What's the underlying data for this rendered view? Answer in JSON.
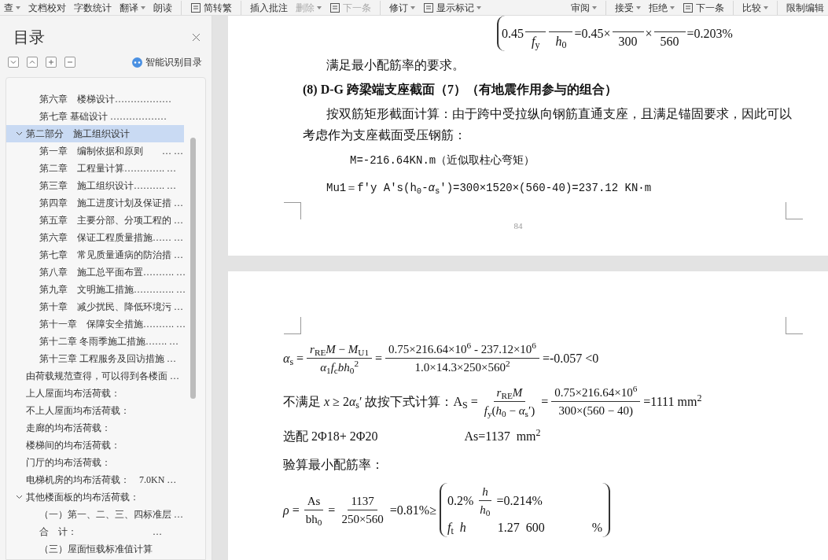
{
  "toolbar": {
    "left": [
      {
        "label": "查",
        "separator_before": false,
        "disabled": false,
        "dropdown": true,
        "icon": false
      },
      {
        "label": "文档校对",
        "separator_before": false,
        "disabled": false,
        "dropdown": false,
        "icon": false
      },
      {
        "label": "字数统计",
        "separator_before": false,
        "disabled": false,
        "dropdown": false,
        "icon": false
      },
      {
        "label": "翻译",
        "separator_before": false,
        "disabled": false,
        "dropdown": true,
        "icon": false
      },
      {
        "label": "朗读",
        "separator_before": false,
        "disabled": false,
        "dropdown": false,
        "icon": false
      },
      {
        "label": "简转繁",
        "separator_before": true,
        "disabled": false,
        "dropdown": false,
        "icon": true
      },
      {
        "label": "插入批注",
        "separator_before": true,
        "disabled": false,
        "dropdown": false,
        "icon": false
      },
      {
        "label": "删除",
        "separator_before": false,
        "disabled": true,
        "dropdown": true,
        "icon": false
      },
      {
        "label": "下一条",
        "separator_before": false,
        "disabled": true,
        "dropdown": false,
        "icon": true
      },
      {
        "label": "修订",
        "separator_before": true,
        "disabled": false,
        "dropdown": true,
        "icon": false
      },
      {
        "label": "显示标记",
        "separator_before": false,
        "disabled": false,
        "dropdown": true,
        "icon": true
      }
    ],
    "right": [
      {
        "label": "审阅",
        "separator_before": false,
        "disabled": false,
        "dropdown": true,
        "icon": false
      },
      {
        "label": "接受",
        "separator_before": true,
        "disabled": false,
        "dropdown": true,
        "icon": false
      },
      {
        "label": "拒绝",
        "separator_before": false,
        "disabled": false,
        "dropdown": true,
        "icon": false
      },
      {
        "label": "下一条",
        "separator_before": false,
        "disabled": false,
        "dropdown": false,
        "icon": true
      },
      {
        "label": "比较",
        "separator_before": true,
        "disabled": false,
        "dropdown": true,
        "icon": false
      },
      {
        "label": "限制编辑",
        "separator_before": true,
        "disabled": false,
        "dropdown": false,
        "icon": false
      }
    ]
  },
  "sidebar": {
    "title": "目录",
    "smart_label": "智能识别目录",
    "continued_children": [
      {
        "label": "第六章　楼梯设计………………",
        "selected": false
      },
      {
        "label": "第七章 基础设计 ………………",
        "selected": false
      }
    ],
    "items": [
      {
        "label": "第二部分　施工组织设计",
        "selected": true,
        "expanded": true,
        "children": [
          {
            "label": "第一章　编制依据和原则　　… …",
            "selected": false
          },
          {
            "label": "第二章　工程量计算…………. …",
            "selected": false
          },
          {
            "label": "第三章　施工组织设计………. …",
            "selected": false
          },
          {
            "label": "第四章　施工进度计划及保证措 …",
            "selected": false
          },
          {
            "label": "第五章　主要分部、分项工程的 …",
            "selected": false
          },
          {
            "label": "第六章　保证工程质量措施…… …",
            "selected": false
          },
          {
            "label": "第七章　常见质量通病的防治措 …",
            "selected": false
          },
          {
            "label": "第八章　施工总平面布置………. …",
            "selected": false
          },
          {
            "label": "第九章　文明施工措施…………. …",
            "selected": false
          },
          {
            "label": "第十章　减少扰民、降低环境污 …",
            "selected": false
          },
          {
            "label": "第十一章　保障安全措施………. …",
            "selected": false
          },
          {
            "label": "第十二章 冬雨季施工措施……. …",
            "selected": false
          },
          {
            "label": "第十三章 工程服务及回访措施 …",
            "selected": false
          }
        ]
      },
      {
        "label": "由荷载规范查得，可以得到各楼面 …",
        "selected": false
      },
      {
        "label": "上人屋面均布活荷载：",
        "selected": false
      },
      {
        "label": "不上人屋面均布活荷载：",
        "selected": false
      },
      {
        "label": "走廊的均布活荷载：",
        "selected": false
      },
      {
        "label": "楼梯间的均布活荷载：",
        "selected": false
      },
      {
        "label": "门厅的均布活荷载：",
        "selected": false
      },
      {
        "label": "电梯机房的均布活荷载：　7.0KN …",
        "selected": false
      },
      {
        "label": "其他楼面板的均布活荷载：",
        "selected": false,
        "expanded": true,
        "children": [
          {
            "label": "（一）第一、二、三、四标准层 …",
            "selected": false
          },
          {
            "label": "合　计：　　　　　　　　…",
            "selected": false
          },
          {
            "label": "（三）屋面恒载标准值计算",
            "selected": false
          }
        ]
      }
    ]
  },
  "pages": [
    {
      "page_number": "84",
      "blocks": [
        {
          "kind": "formula",
          "brace": true,
          "parts": [
            {
              "kind": "text",
              "text": "0.45"
            },
            {
              "kind": "under",
              "den": "*f*$_{y}$"
            },
            {
              "kind": "under",
              "den": "*h*$_{0}$"
            },
            {
              "kind": "text",
              "text": "=0.45×"
            },
            {
              "kind": "under",
              "den": "300"
            },
            {
              "kind": "text",
              "text": "×"
            },
            {
              "kind": "under",
              "den": "560"
            },
            {
              "kind": "text",
              "text": "=0.203%"
            }
          ]
        },
        {
          "kind": "indent",
          "text": "满足最小配筋率的要求。"
        },
        {
          "kind": "heading",
          "text": "(8) D-G 跨梁端支座截面（7）（有地震作用参与的组合）"
        },
        {
          "kind": "indent",
          "text": "按双筋矩形截面计算：由于跨中受拉纵向钢筋直通支座，且满足锚固要求，因此可以考虑作为支座截面受压钢筋："
        },
        {
          "kind": "mono",
          "text": "M=-216.64KN.m（近似取柱心弯矩）"
        },
        {
          "kind": "mono-indent",
          "text": "Mu1＝f'y A's(h$_{0}$-*α*$_{s}$')=300×1520×(560-40)=237.12 KN·m"
        }
      ]
    },
    {
      "blocks": [
        {
          "kind": "formula",
          "parts": [
            {
              "kind": "text",
              "text": "*α*$_{s}$ ="
            },
            {
              "kind": "frac",
              "num": "*r*$_{RE}$*M* − *M*$_{U1}$",
              "den": "*α*$_{1}$*f*$_{c}$*bh*$_{0}$$^{2}$"
            },
            {
              "kind": "text",
              "text": "="
            },
            {
              "kind": "frac",
              "num": "0.75×216.64×10$^{6}$ - 237.12×10$^{6}$",
              "den": "1.0×14.3×250×560$^{2}$"
            },
            {
              "kind": "text",
              "text": "=-0.057 <0"
            }
          ]
        },
        {
          "kind": "formula",
          "parts": [
            {
              "kind": "text",
              "text": "不满足 *x* ≥ 2"
            },
            {
              "kind": "text",
              "text": "*α*$_{s}$′ 故按下式计算：A$_{S}$ ="
            },
            {
              "kind": "frac",
              "num": "*r*$_{RE}$*M*",
              "den": "*f*$_{y}$(*h*$_{0}$ − *α*$_{s}$′)"
            },
            {
              "kind": "text",
              "text": "="
            },
            {
              "kind": "frac",
              "num": "0.75×216.64×10$^{6}$",
              "den": "300×(560 − 40)"
            },
            {
              "kind": "text",
              "text": "=1111 mm$^{2}$"
            }
          ]
        },
        {
          "kind": "formula",
          "parts": [
            {
              "kind": "text",
              "text": "选配 2Φ18+ 2Φ20"
            },
            {
              "kind": "gap"
            },
            {
              "kind": "text",
              "text": "As=1137  mm$^{2}$"
            }
          ]
        },
        {
          "kind": "plain",
          "text": "验算最小配筋率："
        },
        {
          "kind": "formula",
          "parts": [
            {
              "kind": "text",
              "text": "*ρ* ="
            },
            {
              "kind": "frac",
              "num": "As",
              "den": "bh$_{0}$"
            },
            {
              "kind": "text",
              "text": "="
            },
            {
              "kind": "frac",
              "num": "1137",
              "den": "250×560"
            },
            {
              "kind": "text",
              "text": "=0.81%≥"
            },
            {
              "kind": "cases",
              "rows": [
                [
                  {
                    "kind": "text",
                    "text": "0.2%"
                  },
                  {
                    "kind": "frac",
                    "num": "*h*",
                    "den": "*h*$_{0}$"
                  },
                  {
                    "kind": "text",
                    "text": "=0.214%"
                  }
                ],
                [
                  {
                    "kind": "text",
                    "text": "*f*$_{t}$  *h*          1.27  600               %"
                  }
                ]
              ]
            }
          ]
        }
      ]
    }
  ]
}
